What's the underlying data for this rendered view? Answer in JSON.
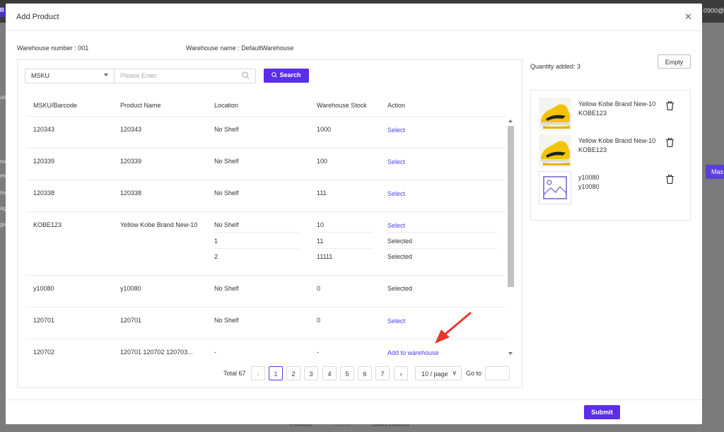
{
  "background": {
    "email_fragment": "0900@e",
    "logo_fragment": "R",
    "side_fragments": [
      "ud",
      "na",
      "es",
      "ne",
      "ag",
      "ge"
    ],
    "side_button": "Mas",
    "bottom_previous": "Previous",
    "bottom_submit": "Submit",
    "bottom_direct_inbound": "Direct Inbound"
  },
  "modal": {
    "title": "Add Product",
    "warehouse_number_label": "Warehouse number :",
    "warehouse_number": "001",
    "warehouse_name_label": "Warehouse name :",
    "warehouse_name": "DefaultWarehouse"
  },
  "search": {
    "field_select": "MSKU",
    "placeholder": "Please Enter",
    "button_label": "Search"
  },
  "table": {
    "columns": [
      "MSKU/Barcode",
      "Product Name",
      "Location",
      "Warehouse Stock",
      "Action"
    ],
    "rows": [
      {
        "msku": "120343",
        "name": "120343",
        "location": "No Shelf",
        "stock": "1000",
        "action": "Select"
      },
      {
        "msku": "120339",
        "name": "120339",
        "location": "No Shelf",
        "stock": "100",
        "action": "Select"
      },
      {
        "msku": "120338",
        "name": "120338",
        "location": "No Shelf",
        "stock": "111",
        "action": "Select"
      },
      {
        "msku": "KOBE123",
        "name": "Yellow Kobe Brand New-10",
        "location": "No Shelf",
        "stock": "10",
        "action": "Select",
        "sub": [
          {
            "location": "1",
            "stock": "11",
            "action": "Selected"
          },
          {
            "location": "2",
            "stock": "11111",
            "action": "Selected"
          }
        ]
      },
      {
        "msku": "y10080",
        "name": "y10080",
        "location": "No Shelf",
        "stock": "0",
        "action": "Selected"
      },
      {
        "msku": "120701",
        "name": "120701",
        "location": "No Shelf",
        "stock": "0",
        "action": "Select"
      },
      {
        "msku": "120702",
        "name": "120701 120702 120703...",
        "location": "-",
        "stock": "-",
        "action": "Add to warehouse"
      }
    ]
  },
  "pagination": {
    "total": "Total 67",
    "pages": [
      "1",
      "2",
      "3",
      "4",
      "5",
      "6",
      "7"
    ],
    "current": "1",
    "page_size": "10 / page",
    "goto_label": "Go to",
    "prev_icon": "chevron-left-icon",
    "next_icon": "chevron-right-icon"
  },
  "cart": {
    "quantity_label": "Quantity added: 3",
    "empty_button": "Empty",
    "items": [
      {
        "name": "Yellow Kobe Brand New-10",
        "sku": "KOBE123",
        "image": "yellow-shoe"
      },
      {
        "name": "Yellow Kobe Brand New-10",
        "sku": "KOBE123",
        "image": "yellow-shoe"
      },
      {
        "name": "y10080",
        "sku": "y10080",
        "image": "image-placeholder-icon"
      }
    ]
  },
  "footer": {
    "submit_label": "Submit"
  },
  "colors": {
    "primary": "#5b2ee8",
    "link": "#4a3ee6",
    "annotation_arrow": "#e8382d"
  }
}
